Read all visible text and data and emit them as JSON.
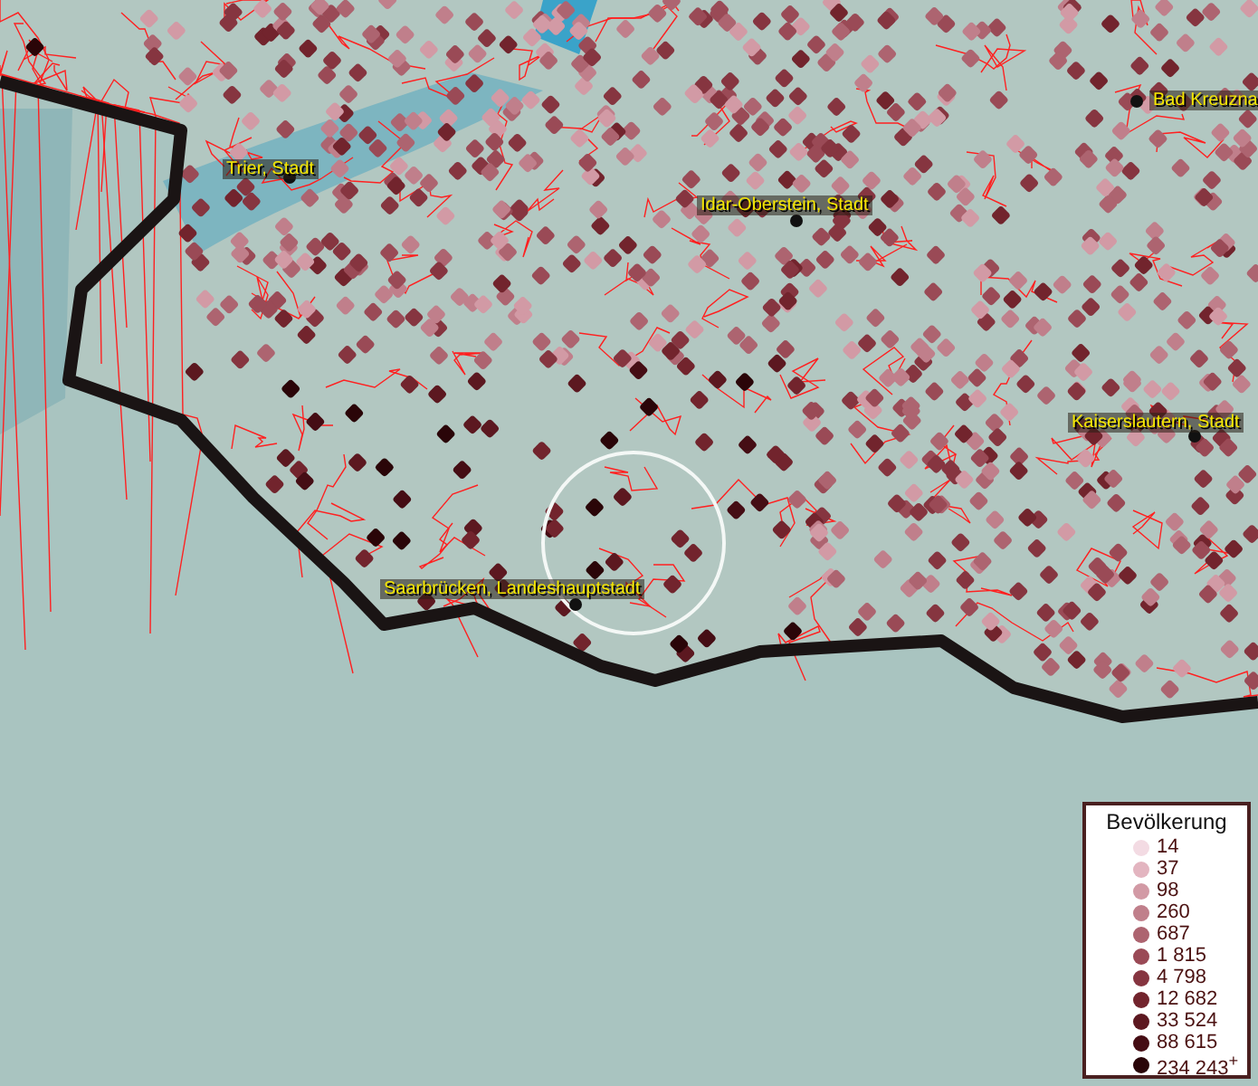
{
  "map": {
    "places": [
      {
        "name": "Trier, Stadt"
      },
      {
        "name": "Idar-Oberstein, Stadt"
      },
      {
        "name": "Bad Kreuzna"
      },
      {
        "name": "Kaiserslautern, Stadt"
      },
      {
        "name": "Saarbrücken, Landeshauptstadt"
      }
    ]
  },
  "legend": {
    "title": "Bevölkerung",
    "items": [
      {
        "label": "14",
        "color": "#f3dbe3"
      },
      {
        "label": "37",
        "color": "#e3b5c0"
      },
      {
        "label": "98",
        "color": "#d29aa5"
      },
      {
        "label": "260",
        "color": "#c07f8b"
      },
      {
        "label": "687",
        "color": "#ad6470"
      },
      {
        "label": "1 815",
        "color": "#9a4a56"
      },
      {
        "label": "4 798",
        "color": "#863540"
      },
      {
        "label": "12 682",
        "color": "#72242d"
      },
      {
        "label": "33 524",
        "color": "#5c1820"
      },
      {
        "label": "88 615",
        "color": "#450d14"
      },
      {
        "label": "234 243$^{+}$",
        "color": "#2a0508"
      }
    ]
  }
}
